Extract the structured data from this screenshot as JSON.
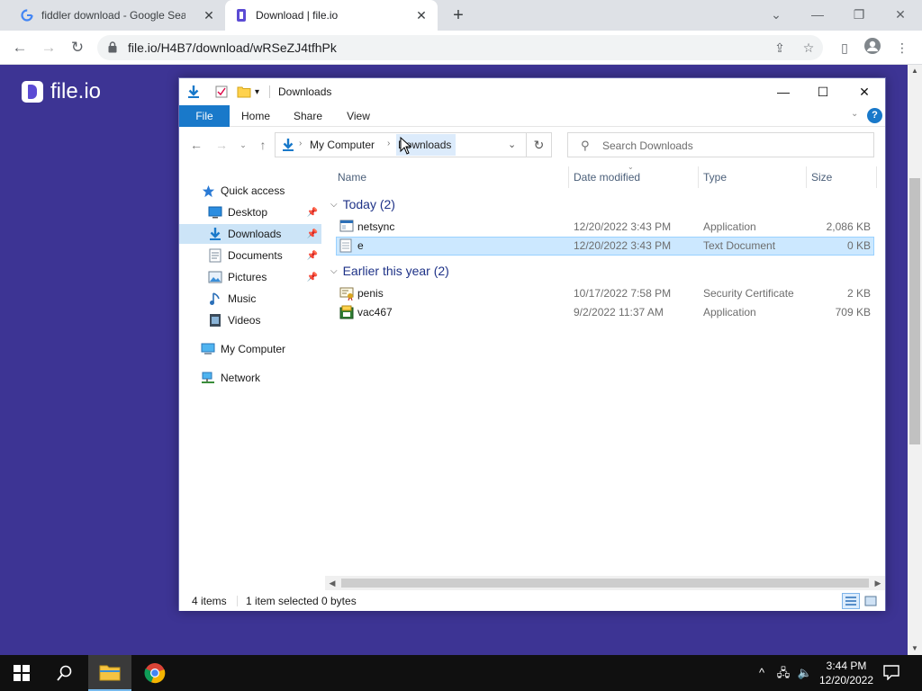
{
  "browser": {
    "tabs": [
      {
        "title": "fiddler download - Google Search",
        "favicon": "google-icon",
        "active": false
      },
      {
        "title": "Download | file.io",
        "favicon": "fileio-icon",
        "active": true
      }
    ],
    "url": "file.io/H4B7/download/wRSeZJ4tfhPk"
  },
  "page": {
    "logo_text": "file.io",
    "brand_color": "#3d3494"
  },
  "explorer": {
    "title": "Downloads",
    "ribbon_tabs": [
      "File",
      "Home",
      "Share",
      "View"
    ],
    "breadcrumb": [
      "My Computer",
      "Downloads"
    ],
    "search_placeholder": "Search Downloads",
    "nav": [
      {
        "label": "Quick access",
        "icon": "star-icon"
      },
      {
        "label": "Desktop",
        "icon": "desktop-icon",
        "pinned": true
      },
      {
        "label": "Downloads",
        "icon": "downloads-icon",
        "pinned": true,
        "selected": true
      },
      {
        "label": "Documents",
        "icon": "documents-icon",
        "pinned": true
      },
      {
        "label": "Pictures",
        "icon": "pictures-icon",
        "pinned": true
      },
      {
        "label": "Music",
        "icon": "music-icon"
      },
      {
        "label": "Videos",
        "icon": "videos-icon"
      },
      {
        "label": "My Computer",
        "icon": "computer-icon"
      },
      {
        "label": "Network",
        "icon": "network-icon"
      }
    ],
    "columns": [
      "Name",
      "Date modified",
      "Type",
      "Size"
    ],
    "groups": [
      {
        "label": "Today (2)",
        "files": [
          {
            "name": "netsync",
            "date": "12/20/2022 3:43 PM",
            "type": "Application",
            "size": "2,086 KB",
            "icon": "application-icon"
          },
          {
            "name": "e",
            "date": "12/20/2022 3:43 PM",
            "type": "Text Document",
            "size": "0 KB",
            "icon": "text-document-icon",
            "selected": true
          }
        ]
      },
      {
        "label": "Earlier this year (2)",
        "files": [
          {
            "name": "penis",
            "date": "10/17/2022 7:58 PM",
            "type": "Security Certificate",
            "size": "2 KB",
            "icon": "certificate-icon"
          },
          {
            "name": "vac467",
            "date": "9/2/2022 11:37 AM",
            "type": "Application",
            "size": "709 KB",
            "icon": "installer-icon"
          }
        ]
      }
    ],
    "status": {
      "items": "4 items",
      "selection": "1 item selected",
      "size": "0 bytes"
    }
  },
  "taskbar": {
    "time": "3:44 PM",
    "date": "12/20/2022"
  }
}
